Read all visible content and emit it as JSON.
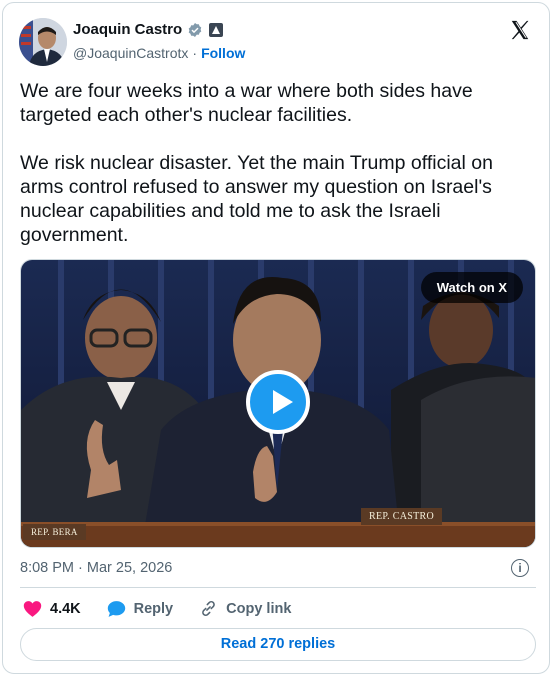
{
  "author": {
    "name": "Joaquin Castro",
    "handle": "@JoaquinCastrotx",
    "separator": "·",
    "follow_label": "Follow"
  },
  "tweet": {
    "paragraph_1": "We are four weeks into a war where both sides have targeted each other's nuclear facilities.",
    "paragraph_2": "We risk nuclear disaster. Yet the main Trump official on arms control refused to answer my question on Israel's nuclear capabilities and told me to ask the Israeli government."
  },
  "media": {
    "watch_label": "Watch on X",
    "plate_left": "REP. BERA",
    "plate_right": "REP. CASTRO"
  },
  "meta": {
    "timestamp": "8:08 PM · Mar 25, 2026",
    "info_glyph": "i"
  },
  "actions": {
    "likes": "4.4K",
    "reply_label": "Reply",
    "copy_label": "Copy link"
  },
  "read_replies_label": "Read 270 replies",
  "colors": {
    "link": "#006fd6",
    "play": "#1d9bf0",
    "heart": "#f91880",
    "verified": "#829aab",
    "border": "#cfd9de"
  }
}
